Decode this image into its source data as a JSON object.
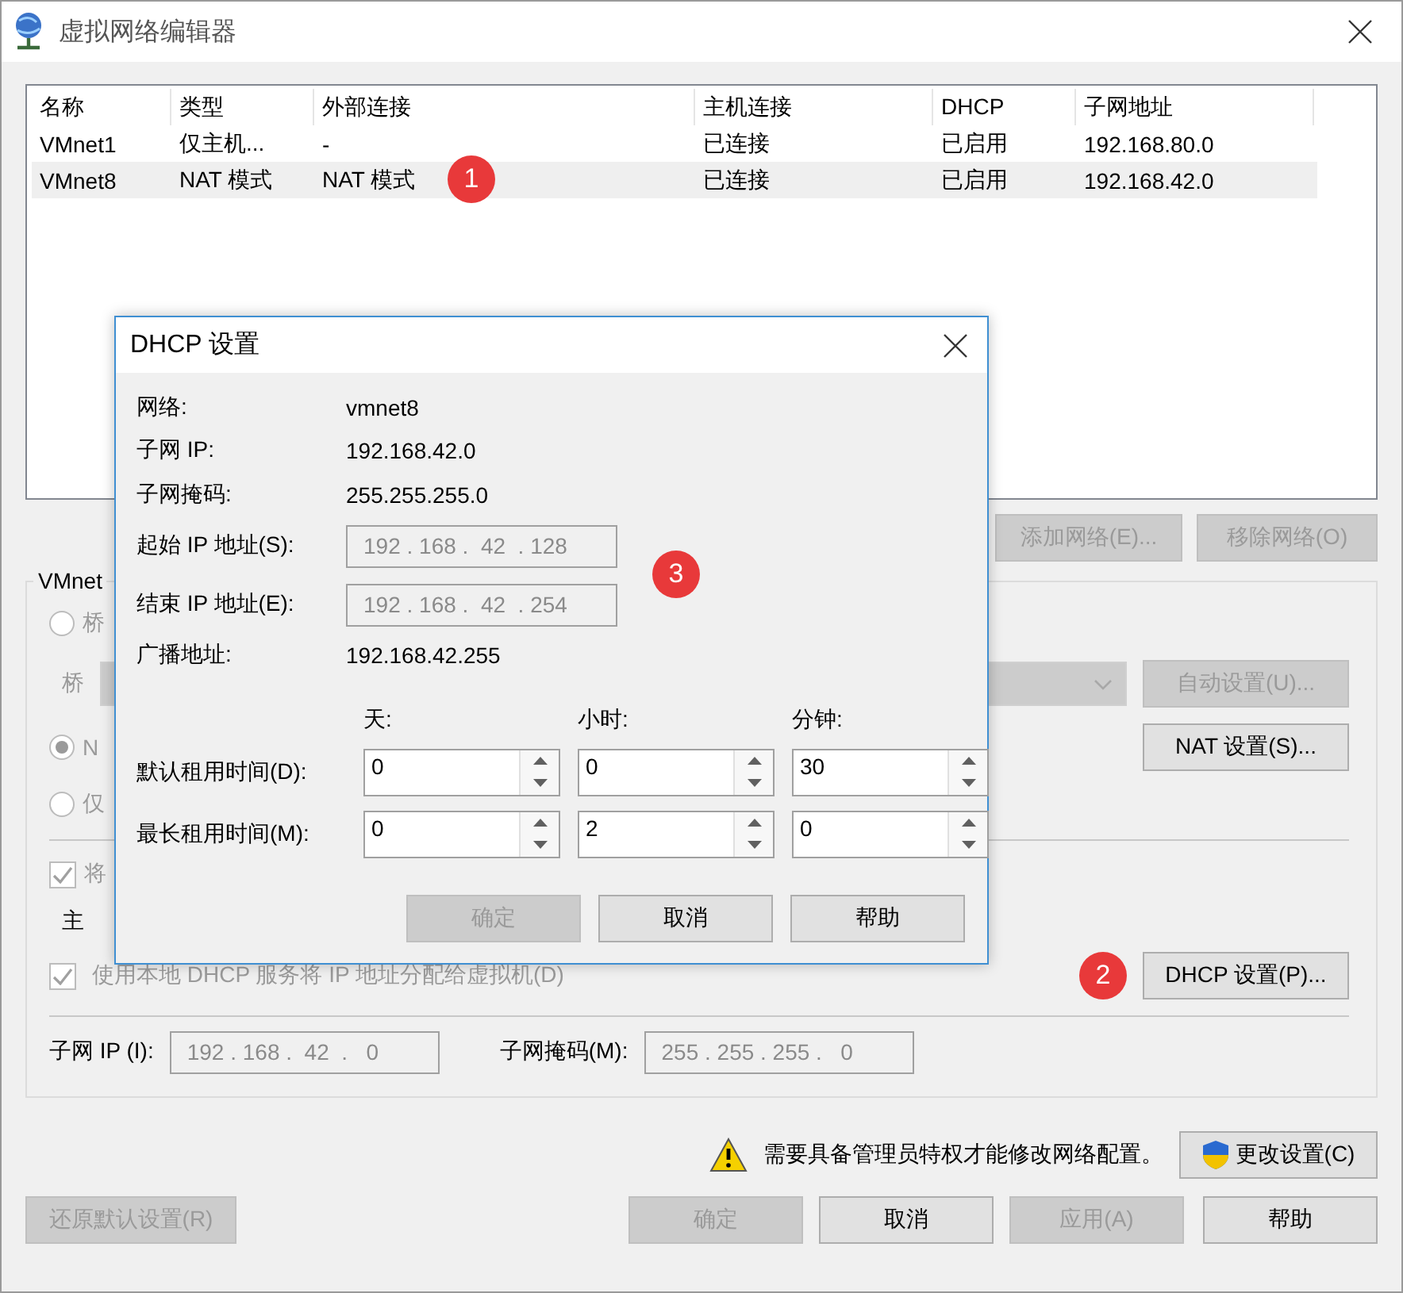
{
  "window": {
    "title": "虚拟网络编辑器"
  },
  "network_table": {
    "columns": [
      "名称",
      "类型",
      "外部连接",
      "主机连接",
      "DHCP",
      "子网地址"
    ],
    "rows": [
      {
        "cells": [
          "VMnet1",
          "仅主机...",
          "-",
          "已连接",
          "已启用",
          "192.168.80.0"
        ],
        "selected": false
      },
      {
        "cells": [
          "VMnet8",
          "NAT 模式",
          "NAT 模式",
          "已连接",
          "已启用",
          "192.168.42.0"
        ],
        "selected": true,
        "badge": "1"
      }
    ]
  },
  "list_buttons": [
    {
      "label": "添加网络(E)...",
      "disabled": true
    },
    {
      "label": "移除网络(O)",
      "disabled": true
    }
  ],
  "vmnet_info": {
    "title": "VMnet",
    "mode_options": [
      {
        "label": "桥",
        "selected": false
      },
      {
        "label": "N",
        "selected": true
      },
      {
        "label": "仅",
        "selected": false
      }
    ],
    "bridge_label": "桥",
    "auto_settings_button": {
      "label": "自动设置(U)...",
      "disabled": true
    },
    "nat_settings_button": {
      "label": "NAT 设置(S)...",
      "disabled": false
    },
    "host_adapter_checkbox": {
      "label": "将",
      "checked": true
    },
    "host_adapter_name_label": "主",
    "dhcp_checkbox": {
      "label": "使用本地 DHCP 服务将 IP 地址分配给虚拟机(D)",
      "checked": true
    },
    "dhcp_settings_button": {
      "label": "DHCP 设置(P)...",
      "disabled": false,
      "badge": "2"
    },
    "subnet_ip": {
      "label": "子网 IP (I):",
      "value": "192 . 168 .  42  .   0"
    },
    "subnet_mask": {
      "label": "子网掩码(M):",
      "value": "255 . 255 . 255 .   0"
    }
  },
  "warning": {
    "text": "需要具备管理员特权才能修改网络配置。"
  },
  "change_settings_button": {
    "label": "更改设置(C)"
  },
  "restore_button": {
    "label": "还原默认设置(R)",
    "disabled": true
  },
  "footer_buttons": [
    {
      "label": "确定",
      "disabled": true
    },
    {
      "label": "取消",
      "disabled": false
    },
    {
      "label": "应用(A)",
      "disabled": true
    },
    {
      "label": "帮助",
      "disabled": false
    }
  ],
  "dhcp_dialog": {
    "title": "DHCP 设置",
    "info": [
      {
        "label": "网络:",
        "value": "vmnet8"
      },
      {
        "label": "子网 IP:",
        "value": "192.168.42.0"
      },
      {
        "label": "子网掩码:",
        "value": "255.255.255.0"
      }
    ],
    "range": [
      {
        "label": "起始 IP 地址(S):",
        "value": "192 . 168 .  42  . 128"
      },
      {
        "label": "结束 IP 地址(E):",
        "value": "192 . 168 .  42  . 254"
      }
    ],
    "range_badge": "3",
    "broadcast": {
      "label": "广播地址:",
      "value": "192.168.42.255"
    },
    "lease_headers": [
      "天:",
      "小时:",
      "分钟:"
    ],
    "lease_rows": [
      {
        "label": "默认租用时间(D):",
        "values": [
          "0",
          "0",
          "30"
        ]
      },
      {
        "label": "最长租用时间(M):",
        "values": [
          "0",
          "2",
          "0"
        ]
      }
    ],
    "buttons": [
      {
        "label": "确定",
        "disabled": true
      },
      {
        "label": "取消",
        "disabled": false
      },
      {
        "label": "帮助",
        "disabled": false
      }
    ]
  }
}
